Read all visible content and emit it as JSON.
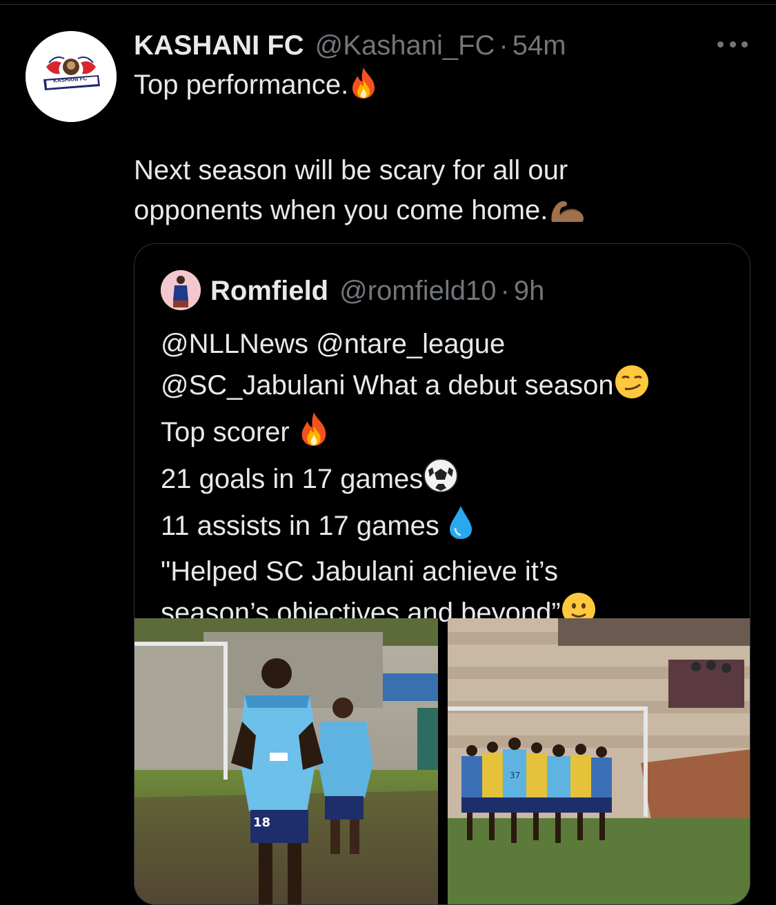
{
  "tweet": {
    "author_name": "KASHANI FC",
    "author_handle": "@Kashani_FC",
    "separator": "·",
    "time": "54m",
    "avatar_logo_text": "KASHANI FC",
    "lines": [
      "Top performance.",
      "Next season will be scary for all our",
      "opponents when you come home."
    ],
    "emojis": [
      "fire-emoji",
      "flexed-biceps-emoji"
    ]
  },
  "quote": {
    "author_name": "Romfield",
    "author_handle": "@romfield10",
    "separator": "·",
    "time": "9h",
    "lines": [
      "@NLLNews @ntare_league",
      "@SC_Jabulani What a debut season",
      "Top scorer ",
      "21 goals in 17 games",
      "11 assists in 17 games ",
      "\"Helped SC Jabulani achieve it’s",
      "season’s objectives and beyond”"
    ],
    "emojis": [
      "smirking-face-emoji",
      "fire-emoji",
      "soccer-ball-emoji",
      "droplet-emoji",
      "slightly-smiling-face-emoji"
    ],
    "photos": [
      {
        "name": "player-celebration-photo",
        "jersey_number": "18"
      },
      {
        "name": "team-huddle-photo",
        "jersey_number": "37"
      }
    ]
  },
  "colors": {
    "background": "#000000",
    "text_primary": "#e7e9ea",
    "text_secondary": "#71767b",
    "border": "#2f3336",
    "jersey_blue": "#5fb3e0"
  }
}
